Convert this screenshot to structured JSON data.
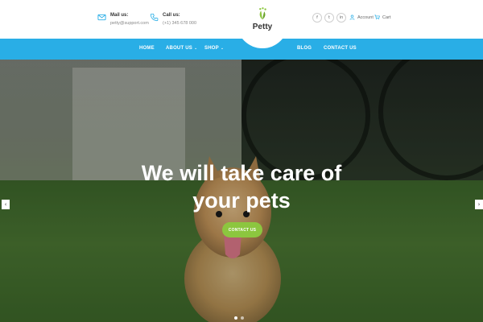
{
  "header": {
    "mail": {
      "label": "Mail us:",
      "value": "petty@support.com",
      "icon": "envelope-icon"
    },
    "call": {
      "label": "Call us:",
      "value": "(+1) 345 678 000",
      "icon": "phone-icon"
    },
    "logo": {
      "text": "Petty",
      "icon": "paw-leaf-icon",
      "color": "#8cc63f"
    },
    "social": [
      {
        "icon": "facebook-icon",
        "glyph": "f"
      },
      {
        "icon": "twitter-icon",
        "glyph": "t"
      },
      {
        "icon": "linkedin-icon",
        "glyph": "in"
      }
    ],
    "account_label": "Account",
    "cart_label": "Cart"
  },
  "nav": {
    "items": [
      {
        "label": "HOME"
      },
      {
        "label": "ABOUT US",
        "dropdown": true
      },
      {
        "label": "SHOP",
        "dropdown": true
      },
      {
        "label": "BLOG"
      },
      {
        "label": "CONTACT US"
      }
    ],
    "color": "#29aee6"
  },
  "hero": {
    "title_line1": "We will take care of",
    "title_line2": "your pets",
    "cta_label": "CONTACT US",
    "cta_color": "#8cc63f",
    "slides": 2,
    "active_slide": 1
  }
}
